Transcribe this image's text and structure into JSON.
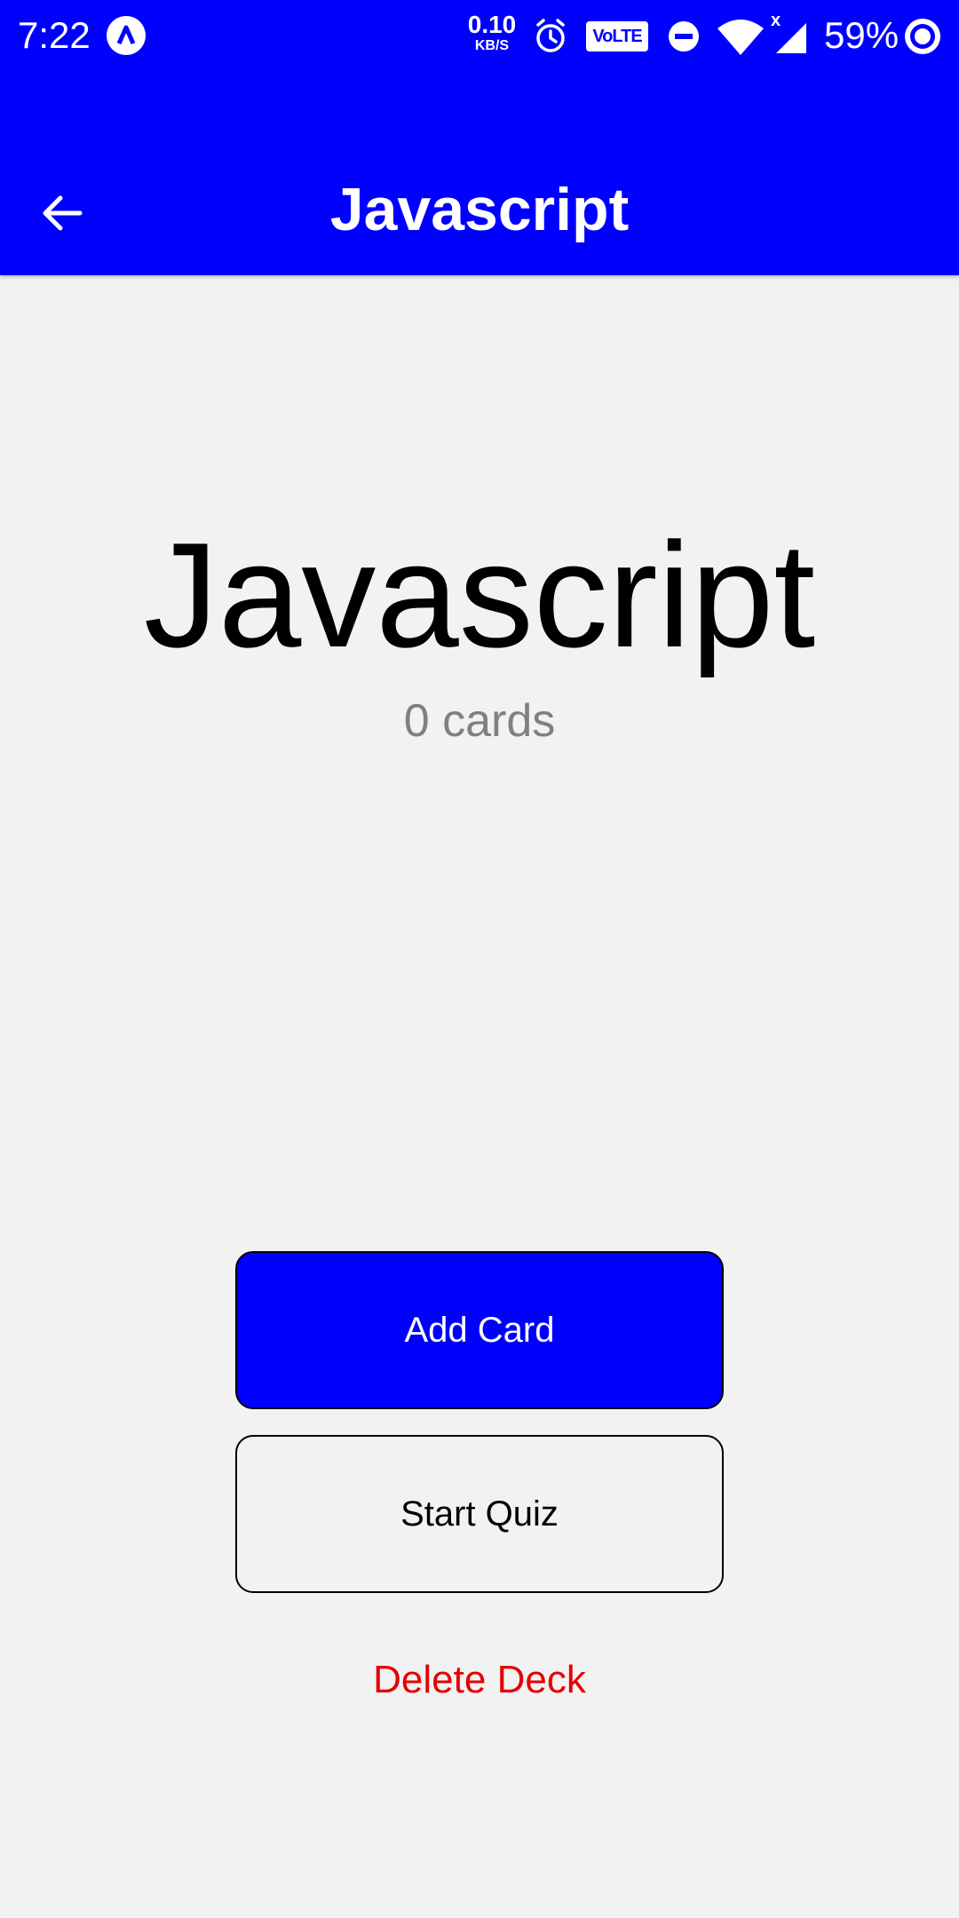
{
  "status_bar": {
    "time": "7:22",
    "net_speed_value": "0.10",
    "net_speed_unit": "KB/S",
    "volte": "VoLTE",
    "signal_marker": "x",
    "battery": "59%",
    "icons": [
      "app-notification-icon",
      "alarm-icon",
      "volte-icon",
      "dnd-icon",
      "wifi-icon",
      "signal-icon",
      "battery-ring-icon"
    ]
  },
  "header": {
    "title": "Javascript",
    "back_icon": "arrow-left-icon",
    "background_color": "#0000ff"
  },
  "deck": {
    "name": "Javascript",
    "card_count": "0 cards"
  },
  "actions": {
    "add_card": "Add Card",
    "start_quiz": "Start Quiz",
    "delete_deck": "Delete Deck"
  },
  "colors": {
    "primary": "#0000ff",
    "background": "#f2f2f2",
    "danger": "#e60000",
    "muted": "#808080"
  }
}
